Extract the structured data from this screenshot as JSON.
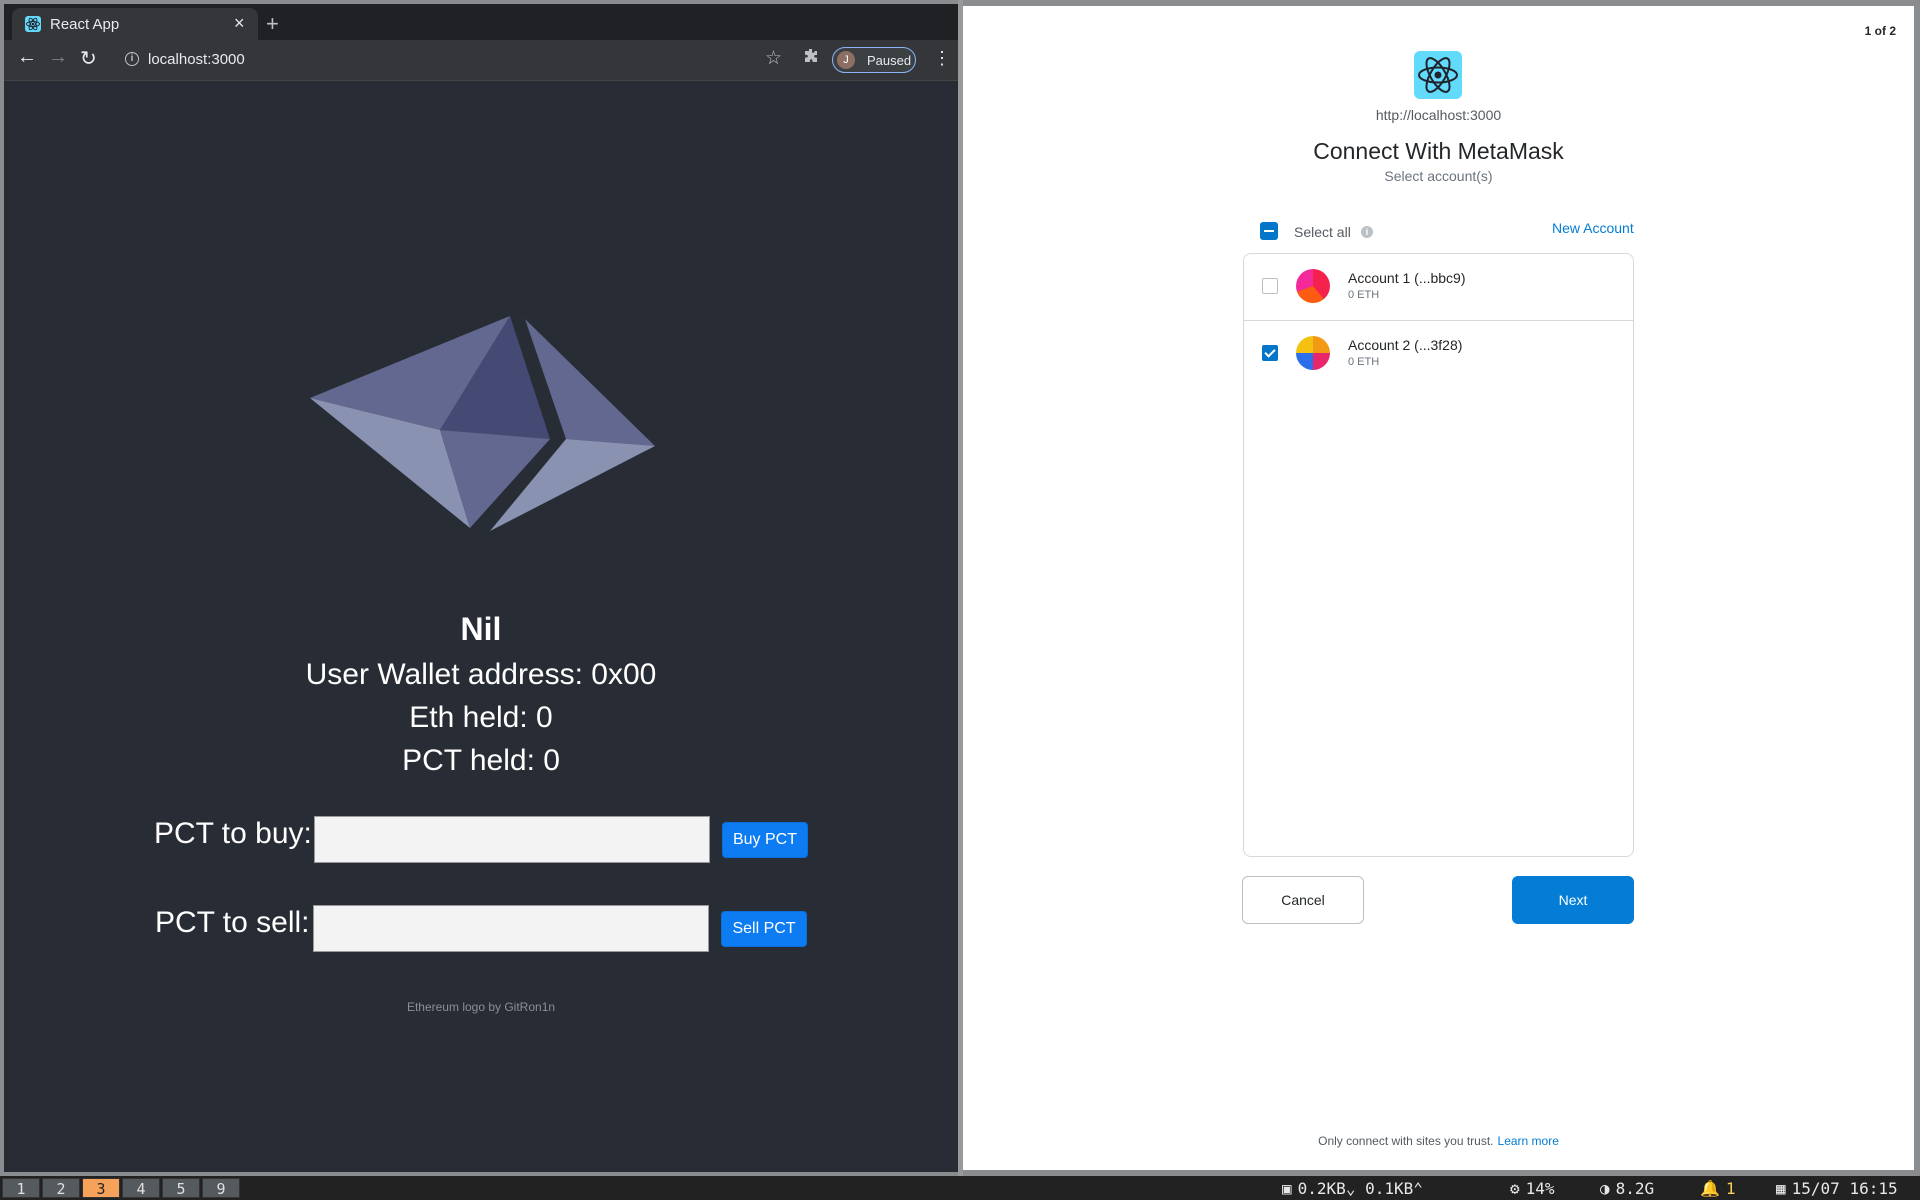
{
  "browser": {
    "tab_title": "React App",
    "tab_close": "×",
    "new_tab": "+",
    "url": "localhost:3000",
    "profile_initial": "J",
    "profile_status": "Paused",
    "nav_back": "←",
    "nav_forward": "→",
    "nav_reload": "↻",
    "star": "☆",
    "menu": "⋮"
  },
  "app": {
    "heading": "Nil",
    "wallet_address": "User Wallet address: 0x00",
    "eth_held": "Eth held: 0",
    "pct_held": "PCT held: 0",
    "buy_label": "PCT to buy:",
    "buy_value": "",
    "buy_button": "Buy PCT",
    "sell_label": "PCT to sell:",
    "sell_value": "",
    "sell_button": "Sell PCT",
    "credit": "Ethereum logo by GitRon1n"
  },
  "metamask": {
    "pager": "1 of 2",
    "site_url": "http://localhost:3000",
    "title": "Connect With MetaMask",
    "subtitle": "Select account(s)",
    "select_all": "Select all",
    "new_account": "New Account",
    "accounts": [
      {
        "name": "Account 1 (...bbc9)",
        "balance": "0 ETH",
        "checked": false
      },
      {
        "name": "Account 2 (...3f28)",
        "balance": "0 ETH",
        "checked": true
      }
    ],
    "cancel": "Cancel",
    "next": "Next",
    "trust_text": "Only connect with sites you trust.",
    "learn_more": "Learn more"
  },
  "statusbar": {
    "workspaces": [
      "1",
      "2",
      "3",
      "4",
      "5",
      "9"
    ],
    "active_workspace": "3",
    "net_down": "0.2KB",
    "net_up": "0.1KB",
    "cpu": "14%",
    "memory": "8.2G",
    "notifications": "1",
    "datetime": "15/07 16:15"
  },
  "colors": {
    "app_bg": "#282c34",
    "button_blue": "#0d7cf2",
    "metamask_blue": "#037dd6",
    "active_workspace": "#f6a25b"
  }
}
